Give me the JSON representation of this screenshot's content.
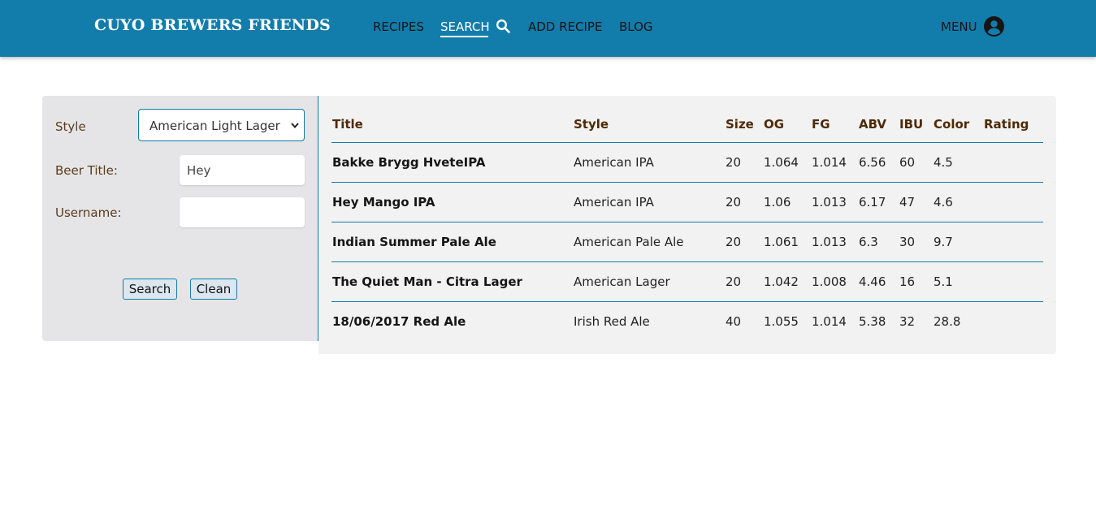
{
  "brand": "CUYO BREWERS FRIENDS",
  "nav": {
    "recipes": "RECIPES",
    "search": "SEARCH",
    "add_recipe": "ADD RECIPE",
    "blog": "BLOG",
    "menu": "MENU"
  },
  "colors": {
    "accent": "#127cab",
    "header_text": "#4e2a06"
  },
  "filters": {
    "style_label": "Style",
    "style_value": "American Light Lager",
    "title_label": "Beer Title:",
    "title_value": "Hey",
    "username_label": "Username:",
    "username_value": "",
    "search_button": "Search",
    "clean_button": "Clean"
  },
  "table": {
    "headers": [
      "Title",
      "Style",
      "Size",
      "OG",
      "FG",
      "ABV",
      "IBU",
      "Color",
      "Rating"
    ],
    "rows": [
      [
        "Bakke Brygg HveteIPA",
        "American IPA",
        "20",
        "1.064",
        "1.014",
        "6.56",
        "60",
        "4.5",
        ""
      ],
      [
        "Hey Mango IPA",
        "American IPA",
        "20",
        "1.06",
        "1.013",
        "6.17",
        "47",
        "4.6",
        ""
      ],
      [
        "Indian Summer Pale Ale",
        "American Pale Ale",
        "20",
        "1.061",
        "1.013",
        "6.3",
        "30",
        "9.7",
        ""
      ],
      [
        "The Quiet Man - Citra Lager",
        "American Lager",
        "20",
        "1.042",
        "1.008",
        "4.46",
        "16",
        "5.1",
        ""
      ],
      [
        "18/06/2017 Red Ale",
        "Irish Red Ale",
        "40",
        "1.055",
        "1.014",
        "5.38",
        "32",
        "28.8",
        ""
      ]
    ]
  }
}
